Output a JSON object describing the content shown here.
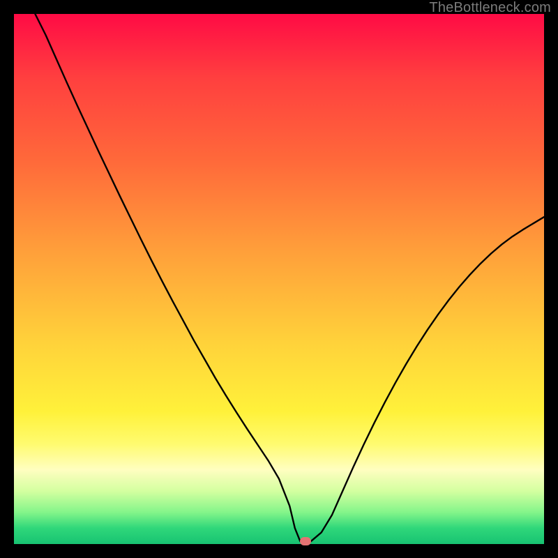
{
  "attribution": "TheBottleneck.com",
  "chart_data": {
    "type": "line",
    "title": "",
    "xlabel": "",
    "ylabel": "",
    "xlim": [
      0,
      100
    ],
    "ylim": [
      0,
      100
    ],
    "x": [
      4,
      6,
      8,
      10,
      12,
      14,
      16,
      18,
      20,
      22,
      24,
      26,
      28,
      30,
      32,
      34,
      36,
      38,
      40,
      42,
      44,
      46,
      48,
      50,
      52,
      53,
      54,
      56,
      58,
      60,
      62,
      64,
      66,
      68,
      70,
      72,
      74,
      76,
      78,
      80,
      82,
      84,
      86,
      88,
      90,
      92,
      94,
      96,
      98,
      100
    ],
    "values": [
      100,
      96,
      91.5,
      87,
      82.6,
      78.3,
      74,
      69.8,
      65.6,
      61.5,
      57.4,
      53.4,
      49.5,
      45.7,
      42,
      38.3,
      34.8,
      31.3,
      28,
      24.8,
      21.7,
      18.7,
      15.7,
      12.3,
      7.2,
      3,
      0.5,
      0.5,
      2.2,
      5.5,
      10,
      14.5,
      18.8,
      22.9,
      26.8,
      30.5,
      34,
      37.3,
      40.4,
      43.3,
      46,
      48.5,
      50.8,
      52.9,
      54.8,
      56.5,
      58,
      59.3,
      60.5,
      61.7
    ],
    "marker": {
      "x": 55,
      "y": 0.5
    },
    "background_gradient": {
      "top": "#ff0b45",
      "mid": "#fff13a",
      "bottom": "#18c372"
    }
  }
}
